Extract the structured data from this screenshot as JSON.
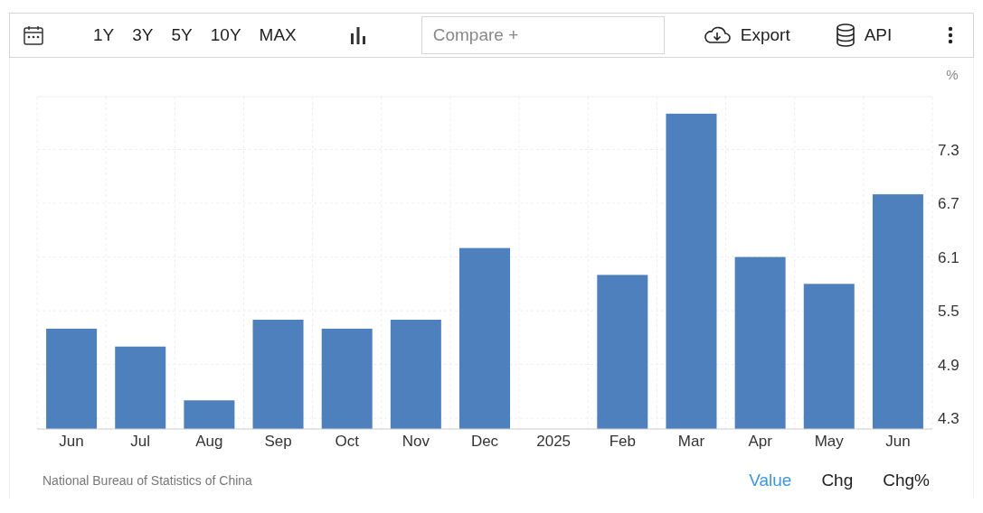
{
  "toolbar": {
    "periods": [
      "1Y",
      "3Y",
      "5Y",
      "10Y",
      "MAX"
    ],
    "compare": {
      "placeholder": "Compare +"
    },
    "export": "Export",
    "api": "API"
  },
  "chart": {
    "chart_data": {
      "type": "bar",
      "ylabel": "%",
      "categories": [
        "Jun",
        "Jul",
        "Aug",
        "Sep",
        "Oct",
        "Nov",
        "Dec",
        "2025",
        "Feb",
        "Mar",
        "Apr",
        "May",
        "Jun"
      ],
      "grid": true,
      "series": [
        {
          "color": "#4d80bc",
          "values": [
            5.3,
            5.1,
            4.5,
            5.4,
            5.3,
            5.4,
            6.2,
            null,
            5.9,
            7.7,
            6.1,
            5.8,
            6.8
          ]
        }
      ],
      "ylim": [
        4.18,
        7.89
      ],
      "yticks": [
        4.3,
        4.9,
        5.5,
        6.1,
        6.7,
        7.3
      ]
    }
  },
  "footer": {
    "source": "National Bureau of Statistics of China",
    "modes": [
      {
        "label": "Value",
        "selected": true
      },
      {
        "label": "Chg",
        "selected": false
      },
      {
        "label": "Chg%",
        "selected": false
      }
    ]
  }
}
